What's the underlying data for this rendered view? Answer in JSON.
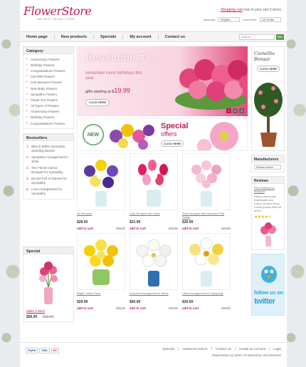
{
  "header": {
    "logo": "FlowerStore",
    "tagline": "THE BEST ONLINE STORE",
    "cart_link": "Shopping cart",
    "cart_text": "now in your cart 0 items",
    "language_label": "language:",
    "language_value": "English",
    "currencies_label": "currencies:",
    "currency_value": "US Dollar"
  },
  "nav": {
    "items": [
      "Home page",
      "New products",
      "Specials",
      "My account",
      "Contact us"
    ],
    "search_placeholder": "Search",
    "go_label": "Go!"
  },
  "categories": {
    "title": "Category",
    "items": [
      "Anniversary Flowers",
      "Birthday Flowers",
      "Congratulations Flowers",
      "Get Well Flowers",
      "Just Because Flowers",
      "New Baby Flowers",
      "Sympathy Flowers",
      "Thank You Flowers",
      "All Types of Flowers",
      "Anniversary Flowers",
      "Birthday Flowers",
      "Congratulations Flowers"
    ]
  },
  "bestsellers": {
    "title": "Bestsellers",
    "items": [
      {
        "num": "1.",
        "text": "Blue & White Sympathy Standing Basket"
      },
      {
        "num": "2.",
        "text": "Sympathy Arrangement in white"
      },
      {
        "num": "3.",
        "text": "The Florist Classic Bouquet for Sympathy"
      },
      {
        "num": "4.",
        "text": "Bucket Full of Daisies for Sympathy"
      },
      {
        "num": "5.",
        "text": "Love Arrangement for Sympathy"
      }
    ]
  },
  "special": {
    "title": "Special",
    "name": "Make a Wish",
    "new_price": "$56.00",
    "old_price": "$56.00"
  },
  "banner": {
    "title": "Resolution #1:",
    "subtitle": "remember more birthdays this year",
    "price_prefix": "gifts starting at $",
    "price": "19.99",
    "button": "CLICK HERE",
    "pages": [
      "1",
      "2",
      "3"
    ]
  },
  "banner_special": {
    "badge": "NEW",
    "title": "Special",
    "subtitle": "offers",
    "button": "CLICK HERE"
  },
  "bonsai": {
    "title": "Camellia Bonsai",
    "button": "CLICK HERE"
  },
  "manufacturers": {
    "title": "Manufacturers",
    "select_value": "Please select"
  },
  "reviews": {
    "title": "Reviews",
    "product": "Pink Reflections Bouquet",
    "text": "Donec accumsan malesuada orci. Donec sit amet eros. Lorem ipsum dolor sit amet...",
    "rating": 4,
    "max_rating": 5
  },
  "twitter": {
    "follow": "follow us on",
    "word": "twitter"
  },
  "products": [
    {
      "name": "Iris Bouquet",
      "price": "$28.00",
      "add": "add to cart",
      "details": "details",
      "flower": "iris"
    },
    {
      "name": "Tulip Bouquet with Vase",
      "price": "$23.99",
      "add": "add to cart",
      "details": "details",
      "flower": "tulip"
    },
    {
      "name": "Rose Bouquet with Assorted Pink Roses",
      "price": "$39.99",
      "add": "add to cart",
      "details": "details",
      "flower": "rose"
    },
    {
      "name": "Bright Yellow Rose",
      "price": "$29.99",
      "add": "add to cart",
      "details": "details",
      "flower": "yellow"
    },
    {
      "name": "Graceful Arrangement in White",
      "price": "$56.99",
      "add": "add to cart",
      "details": "details",
      "flower": "white"
    },
    {
      "name": "Lilies Arrangement for Sympathy",
      "price": "$39.99",
      "add": "add to cart",
      "details": "details",
      "flower": "lily"
    }
  ],
  "footer": {
    "payments": [
      "PayPal",
      "VISA",
      "MC"
    ],
    "links": [
      "Specials",
      "Advanced Search",
      "Contact Us",
      "Create an Account",
      "Login"
    ],
    "copyright": "FlowerStore (c) 2011 | Powered by osCommerce"
  },
  "colors": {
    "accent": "#c2185b",
    "go": "#5a9a5a",
    "twitter": "#2ca1d8"
  }
}
